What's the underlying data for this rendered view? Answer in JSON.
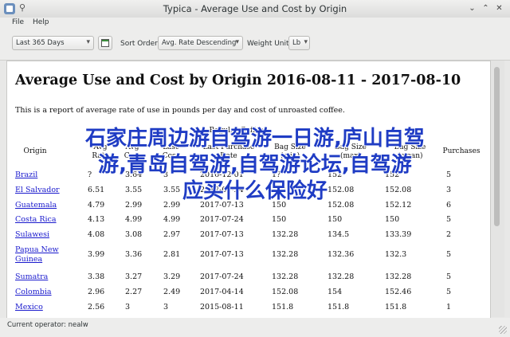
{
  "window": {
    "title": "Typica - Average Use and Cost by Origin"
  },
  "menu": {
    "file": "File",
    "help": "Help"
  },
  "toolbar": {
    "date_range": "Last 365 Days",
    "sort_label": "Sort Order:",
    "sort_value": "Avg. Rate Descending",
    "weight_label": "Weight Unit:",
    "weight_value": "Lb"
  },
  "report": {
    "title": "Average Use and Cost by Origin 2016-08-11 - 2017-08-10",
    "subtitle": "This is a report of average rate of use in pounds per day and cost of unroasted coffee.",
    "group_header": "Regular Coffees",
    "columns": [
      {
        "line1": "Origin",
        "line2": ""
      },
      {
        "line1": "Avg",
        "line2": "Rate"
      },
      {
        "line1": "Avg",
        "line2": "Cost"
      },
      {
        "line1": "Last",
        "line2": "Cost"
      },
      {
        "line1": "Last Purchase",
        "line2": "Date"
      },
      {
        "line1": "Bag Size",
        "line2": "(min)"
      },
      {
        "line1": "Bag Size",
        "line2": "(max)"
      },
      {
        "line1": "Bag Size",
        "line2": "(mean)"
      },
      {
        "line1": "Purchases",
        "line2": ""
      }
    ],
    "rows": [
      {
        "origin": "Brazil",
        "rate": "?",
        "avg_cost": "3.64",
        "last_cost": "3",
        "date": "2016-12-01",
        "min": "1?",
        "max": "152",
        "mean": "152",
        "purchases": "5",
        "origin_line2": ""
      },
      {
        "origin": "El Salvador",
        "rate": "6.51",
        "avg_cost": "3.55",
        "last_cost": "3.55",
        "date": "2017-07-24",
        "min": "152.08",
        "max": "152.08",
        "mean": "152.08",
        "purchases": "3",
        "origin_line2": ""
      },
      {
        "origin": "Guatemala",
        "rate": "4.79",
        "avg_cost": "2.99",
        "last_cost": "2.99",
        "date": "2017-07-13",
        "min": "150",
        "max": "152.08",
        "mean": "152.12",
        "purchases": "6",
        "origin_line2": ""
      },
      {
        "origin": "Costa Rica",
        "rate": "4.13",
        "avg_cost": "4.99",
        "last_cost": "4.99",
        "date": "2017-07-24",
        "min": "150",
        "max": "150",
        "mean": "150",
        "purchases": "5",
        "origin_line2": ""
      },
      {
        "origin": "Sulawesi",
        "rate": "4.08",
        "avg_cost": "3.08",
        "last_cost": "2.97",
        "date": "2017-07-13",
        "min": "132.28",
        "max": "134.5",
        "mean": "133.39",
        "purchases": "2",
        "origin_line2": ""
      },
      {
        "origin": "Papua New",
        "origin_line2": "Guinea",
        "rate": "3.99",
        "avg_cost": "3.36",
        "last_cost": "2.81",
        "date": "2017-07-13",
        "min": "132.28",
        "max": "132.36",
        "mean": "132.3",
        "purchases": "5"
      },
      {
        "origin": "Sumatra",
        "rate": "3.38",
        "avg_cost": "3.27",
        "last_cost": "3.29",
        "date": "2017-07-24",
        "min": "132.28",
        "max": "132.28",
        "mean": "132.28",
        "purchases": "5",
        "origin_line2": ""
      },
      {
        "origin": "Colombia",
        "rate": "2.96",
        "avg_cost": "2.27",
        "last_cost": "2.49",
        "date": "2017-04-14",
        "min": "152.08",
        "max": "154",
        "mean": "152.46",
        "purchases": "5",
        "origin_line2": ""
      },
      {
        "origin": "Mexico",
        "rate": "2.56",
        "avg_cost": "3",
        "last_cost": "3",
        "date": "2015-08-11",
        "min": "151.8",
        "max": "151.8",
        "mean": "151.8",
        "purchases": "1",
        "origin_line2": ""
      }
    ]
  },
  "overlay": {
    "line1": "石家庄周边游自驾游一日游,庐山自驾",
    "line2": "游,青岛自驾游,自驾游论坛,自驾游",
    "line3": "应买什么保险好"
  },
  "status": {
    "text": "Current operator: nealw"
  },
  "colors": {
    "link": "#1a1acd",
    "overlay_text": "#1f3cc4"
  }
}
